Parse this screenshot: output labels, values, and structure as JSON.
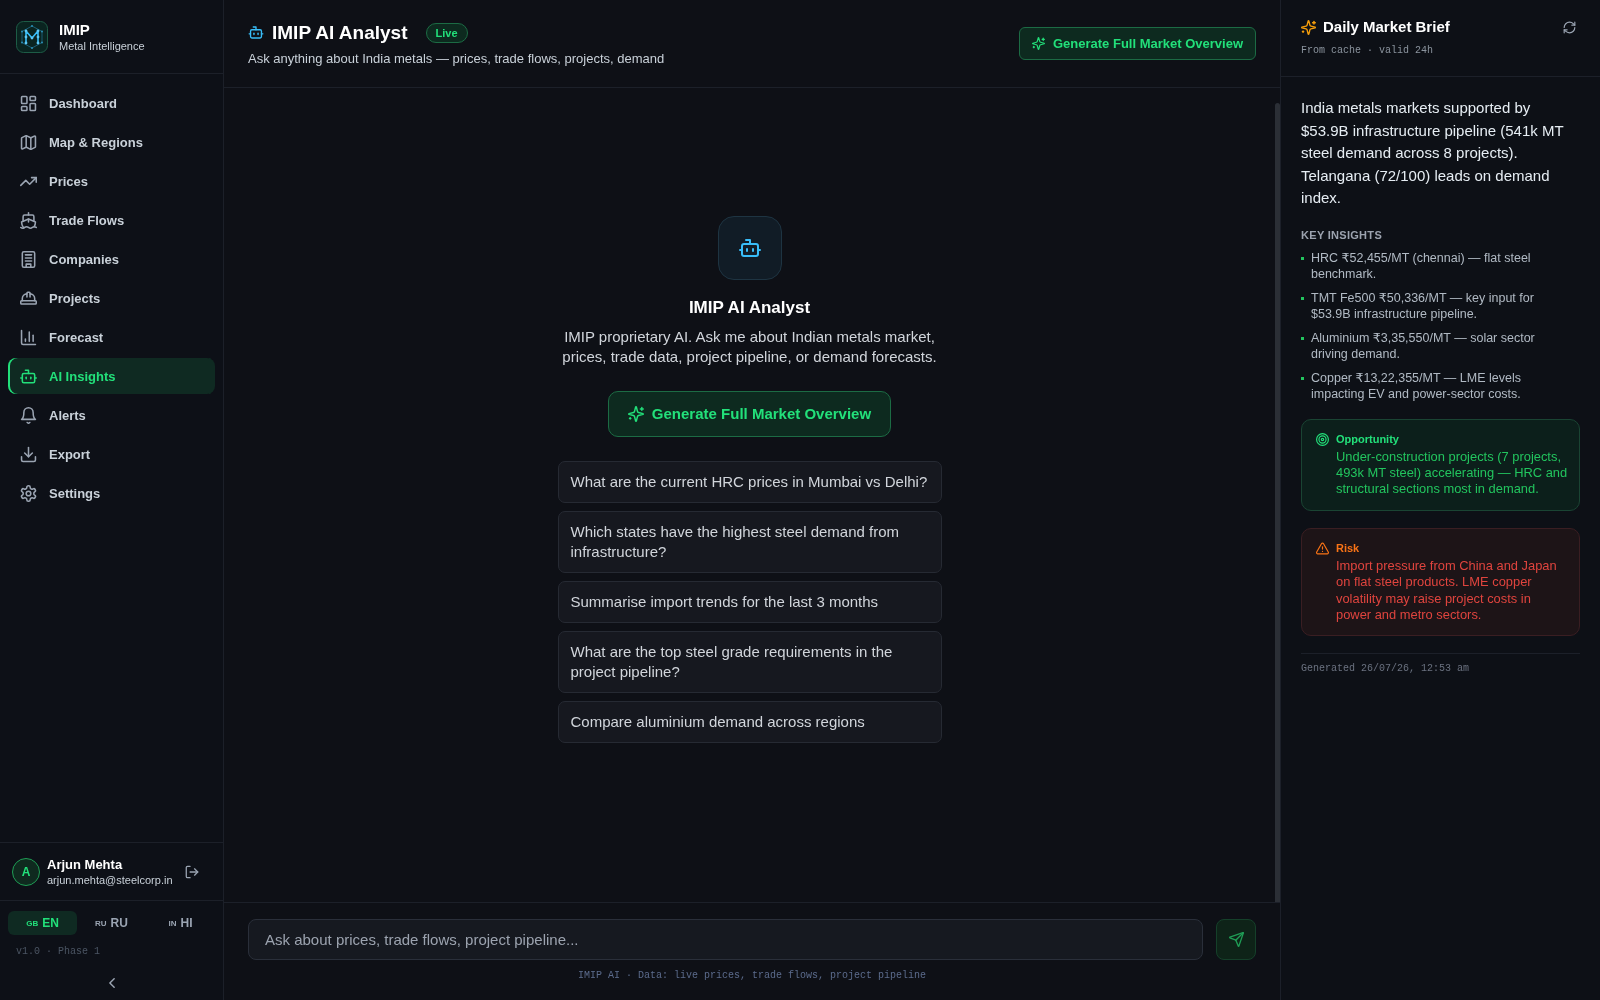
{
  "sidebar": {
    "brand": {
      "name": "IMIP",
      "tagline": "Metal Intelligence"
    },
    "nav_items": [
      {
        "label": "Dashboard",
        "selected": false
      },
      {
        "label": "Map & Regions",
        "selected": false
      },
      {
        "label": "Prices",
        "selected": false
      },
      {
        "label": "Trade Flows",
        "selected": false
      },
      {
        "label": "Companies",
        "selected": false
      },
      {
        "label": "Projects",
        "selected": false
      },
      {
        "label": "Forecast",
        "selected": false
      },
      {
        "label": "AI Insights",
        "selected": true
      },
      {
        "label": "Alerts",
        "selected": false
      },
      {
        "label": "Export",
        "selected": false
      },
      {
        "label": "Settings",
        "selected": false
      }
    ],
    "user": {
      "initial": "A",
      "name": "Arjun Mehta",
      "email": "arjun.mehta@steelcorp.in"
    },
    "languages": [
      {
        "flag": "GB",
        "label": "EN",
        "selected": true
      },
      {
        "flag": "RU",
        "label": "RU",
        "selected": false
      },
      {
        "flag": "IN",
        "label": "HI",
        "selected": false
      }
    ],
    "version": "v1.0 · Phase 1"
  },
  "header": {
    "title": "IMIP AI Analyst",
    "badge": "Live",
    "subtitle": "Ask anything about India metals — prices, trade flows, projects, demand",
    "action": "Generate Full Market Overview"
  },
  "welcome": {
    "title": "IMIP AI Analyst",
    "description": "IMIP proprietary AI. Ask me about Indian metals market, prices, trade data, project pipeline, or demand forecasts.",
    "action": "Generate Full Market Overview",
    "suggestions": [
      "What are the current HRC prices in Mumbai vs Delhi?",
      "Which states have the highest steel demand from infrastructure?",
      "Summarise import trends for the last 3 months",
      "What are the top steel grade requirements in the project pipeline?",
      "Compare aluminium demand across regions"
    ]
  },
  "composer": {
    "placeholder": "Ask about prices, trade flows, project pipeline...",
    "footnote": "IMIP AI · Data: live prices, trade flows, project pipeline"
  },
  "brief": {
    "title": "Daily Market Brief",
    "meta": "From cache · valid 24h",
    "summary": "India metals markets supported by $53.9B infrastructure pipeline (541k MT steel demand across 8 projects). Telangana (72/100) leads on demand index.",
    "insights_heading": "KEY INSIGHTS",
    "insights": [
      "HRC ₹52,455/MT (chennai) — flat steel benchmark.",
      "TMT Fe500 ₹50,336/MT — key input for $53.9B infrastructure pipeline.",
      "Aluminium ₹3,35,550/MT — solar sector driving demand.",
      "Copper ₹13,22,355/MT — LME levels impacting EV and power-sector costs."
    ],
    "callouts": [
      {
        "kind": "opportunity",
        "title": "Opportunity",
        "text": "Under-construction projects (7 projects, 493k MT steel) accelerating — HRC and structural sections most in demand."
      },
      {
        "kind": "risk",
        "title": "Risk",
        "text": "Import pressure from China and Japan on flat steel products. LME copper volatility may raise project costs in power and metro sectors."
      }
    ],
    "generated": "Generated 26/07/26, 12:53 am"
  }
}
